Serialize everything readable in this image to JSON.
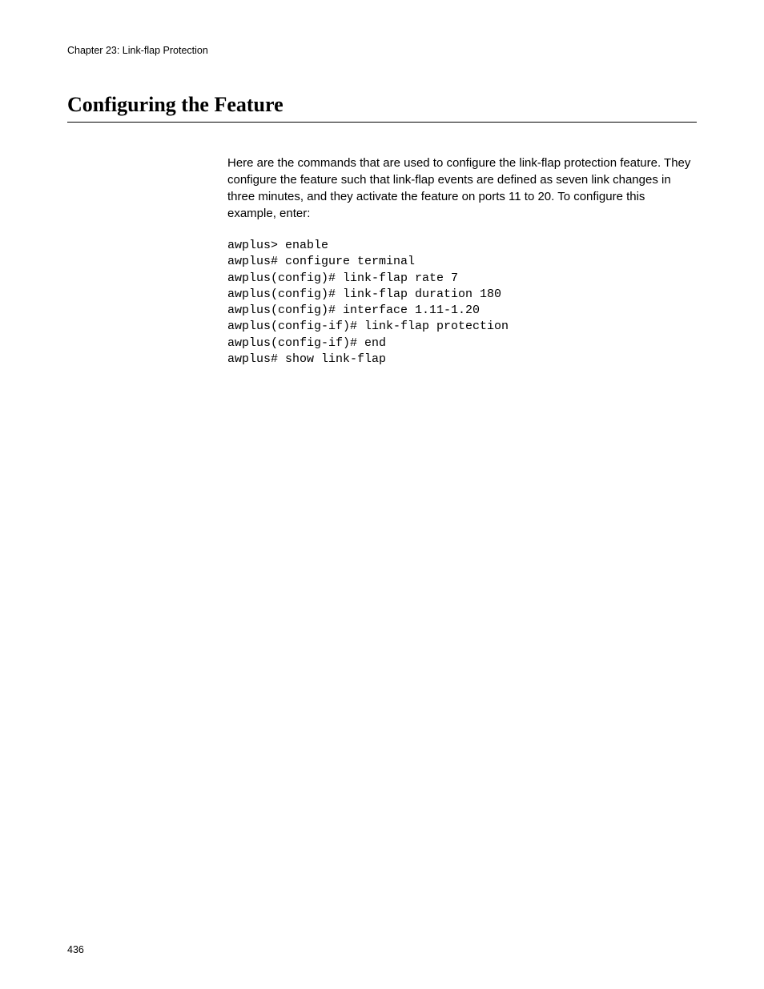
{
  "header": {
    "chapter_line": "Chapter 23: Link-flap Protection"
  },
  "section": {
    "heading": "Configuring the Feature",
    "intro_paragraph": "Here are the commands that are used to configure the link-flap protection feature. They configure the feature such that link-flap events are defined as seven link changes in three minutes, and they activate the feature on ports 11 to 20. To configure this example, enter:",
    "code_lines": "awplus> enable\nawplus# configure terminal\nawplus(config)# link-flap rate 7\nawplus(config)# link-flap duration 180\nawplus(config)# interface 1.11-1.20\nawplus(config-if)# link-flap protection\nawplus(config-if)# end\nawplus# show link-flap"
  },
  "footer": {
    "page_number": "436"
  }
}
